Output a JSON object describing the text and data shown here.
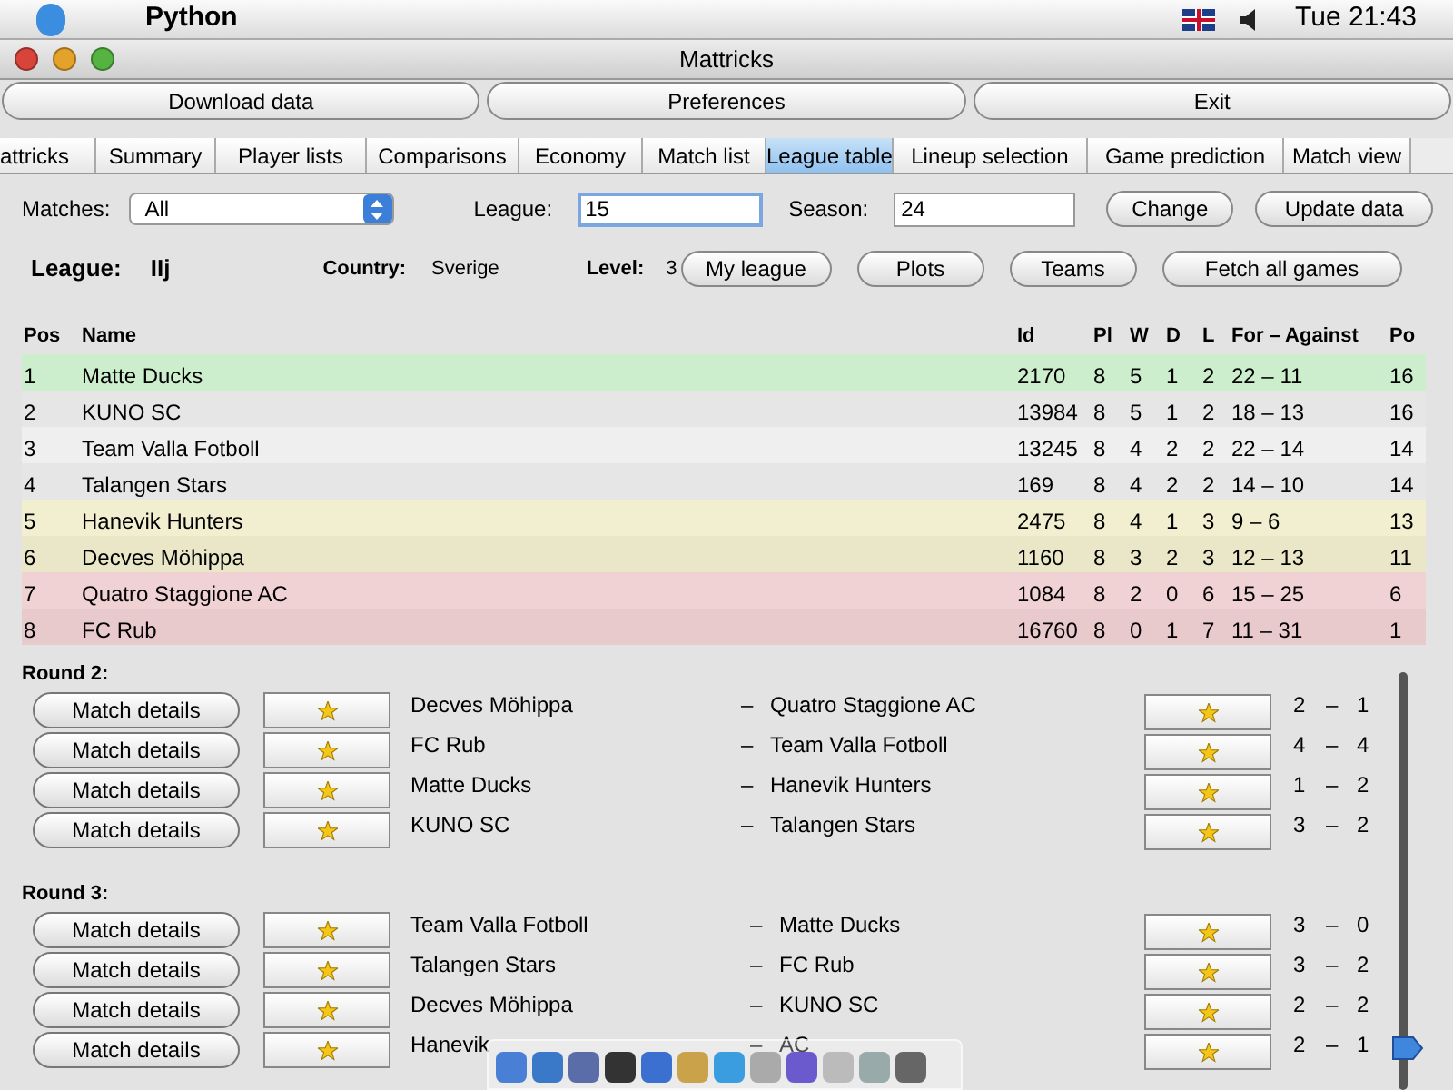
{
  "menu_bar": {
    "app": "Python",
    "clock": "Tue 21:43"
  },
  "window": {
    "title": "Mattricks"
  },
  "toolbar": [
    "Download data",
    "Preferences",
    "Exit"
  ],
  "tabs": [
    {
      "label": "attricks",
      "selected": false
    },
    {
      "label": "Summary",
      "selected": false
    },
    {
      "label": "Player lists",
      "selected": false
    },
    {
      "label": "Comparisons",
      "selected": false
    },
    {
      "label": "Economy",
      "selected": false
    },
    {
      "label": "Match list",
      "selected": false
    },
    {
      "label": "League table",
      "selected": true
    },
    {
      "label": "Lineup selection",
      "selected": false
    },
    {
      "label": "Game prediction",
      "selected": false
    },
    {
      "label": "Match view",
      "selected": false
    }
  ],
  "filters": {
    "matches_label": "Matches:",
    "matches_value": "All",
    "league_label": "League:",
    "league_value": "15",
    "season_label": "Season:",
    "season_value": "24",
    "buttons": [
      "Change",
      "Update data"
    ]
  },
  "league_info": {
    "league_label": "League:",
    "league_value": "IIj",
    "country_label": "Country:",
    "country_value": "Sverige",
    "level_label": "Level:",
    "level_value": "3",
    "buttons": [
      "My league",
      "Plots",
      "Teams",
      "Fetch all games"
    ]
  },
  "table": {
    "columns": [
      "Pos",
      "Name",
      "Id",
      "Pl",
      "W",
      "D",
      "L",
      "For – Against",
      "Po"
    ],
    "rows": [
      {
        "color": "#cdeecd",
        "cells": [
          "1",
          "Matte Ducks",
          "2170",
          "8",
          "5",
          "1",
          "2",
          "22 – 11",
          "16"
        ]
      },
      {
        "color": "#e6e6e6",
        "cells": [
          "2",
          "KUNO SC",
          "13984",
          "8",
          "5",
          "1",
          "2",
          "18 – 13",
          "16"
        ]
      },
      {
        "color": "#efefef",
        "cells": [
          "3",
          "Team Valla Fotboll",
          "13245",
          "8",
          "4",
          "2",
          "2",
          "22 – 14",
          "14"
        ]
      },
      {
        "color": "#e6e6e6",
        "cells": [
          "4",
          "Talangen Stars",
          "169",
          "8",
          "4",
          "2",
          "2",
          "14 – 10",
          "14"
        ]
      },
      {
        "color": "#f1efd0",
        "cells": [
          "5",
          "Hanevik Hunters",
          "2475",
          "8",
          "4",
          "1",
          "3",
          "9 – 6",
          "13"
        ]
      },
      {
        "color": "#e9e7c8",
        "cells": [
          "6",
          "Decves Möhippa",
          "1160",
          "8",
          "3",
          "2",
          "3",
          "12 – 13",
          "11"
        ]
      },
      {
        "color": "#f1d2d4",
        "cells": [
          "7",
          "Quatro Staggione AC",
          "1084",
          "8",
          "2",
          "0",
          "6",
          "15 – 25",
          "6"
        ]
      },
      {
        "color": "#e9cacc",
        "cells": [
          "8",
          "FC Rub",
          "16760",
          "8",
          "0",
          "1",
          "7",
          "11 – 31",
          "1"
        ]
      }
    ]
  },
  "rounds": [
    {
      "title": "Round 2:",
      "matches": [
        {
          "button": "Match details",
          "home": "Decves Möhippa",
          "sep": "–",
          "away": "Quatro Staggione AC",
          "home_goals": "2",
          "dash": "–",
          "away_goals": "1"
        },
        {
          "button": "Match details",
          "home": "FC Rub",
          "sep": "–",
          "away": "Team Valla Fotboll",
          "home_goals": "4",
          "dash": "–",
          "away_goals": "4"
        },
        {
          "button": "Match details",
          "home": "Matte Ducks",
          "sep": "–",
          "away": "Hanevik Hunters",
          "home_goals": "1",
          "dash": "–",
          "away_goals": "2"
        },
        {
          "button": "Match details",
          "home": "KUNO SC",
          "sep": "–",
          "away": "Talangen Stars",
          "home_goals": "3",
          "dash": "–",
          "away_goals": "2"
        }
      ]
    },
    {
      "title": "Round 3:",
      "matches": [
        {
          "button": "Match details",
          "home": "Team Valla Fotboll",
          "sep": "–",
          "away": "Matte Ducks",
          "home_goals": "3",
          "dash": "–",
          "away_goals": "0"
        },
        {
          "button": "Match details",
          "home": "Talangen Stars",
          "sep": "–",
          "away": "FC Rub",
          "home_goals": "3",
          "dash": "–",
          "away_goals": "2"
        },
        {
          "button": "Match details",
          "home": "Decves Möhippa",
          "sep": "–",
          "away": "KUNO SC",
          "home_goals": "2",
          "dash": "–",
          "away_goals": "2"
        },
        {
          "button": "Match details",
          "home": "Hanevik",
          "sep": "–",
          "away": "AC",
          "home_goals": "2",
          "dash": "–",
          "away_goals": "1"
        }
      ]
    }
  ]
}
